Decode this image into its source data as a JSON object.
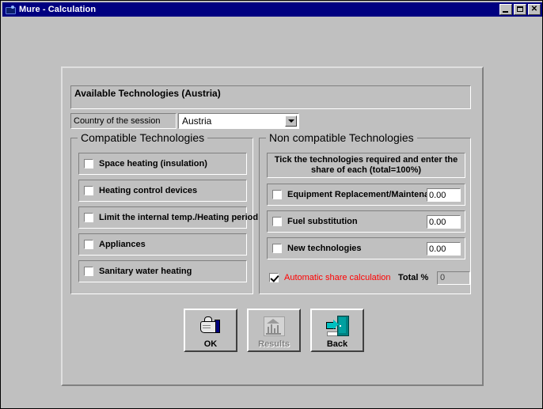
{
  "window": {
    "title": "Mure - Calculation",
    "icon": "app-icon",
    "controls": [
      {
        "name": "minimize",
        "glyph": "_"
      },
      {
        "name": "restore",
        "glyph": "❐"
      },
      {
        "name": "close",
        "glyph": "✕"
      }
    ]
  },
  "panel": {
    "header": "Available Technologies (Austria)",
    "country": {
      "label": "Country of the session",
      "value": "Austria",
      "options": [
        "Austria"
      ]
    }
  },
  "compatible": {
    "title": "Compatible Technologies",
    "items": [
      {
        "label": "Space heating (insulation)",
        "checked": false
      },
      {
        "label": "Heating control devices",
        "checked": false
      },
      {
        "label": "Limit the internal temp./Heating period",
        "checked": false
      },
      {
        "label": "Appliances",
        "checked": false
      },
      {
        "label": "Sanitary water heating",
        "checked": false
      }
    ]
  },
  "non_compatible": {
    "title": "Non compatible Technologies",
    "instruction": "Tick the technologies required and enter the share of each (total=100%)",
    "items": [
      {
        "label": "Equipment Replacement/Maintenance",
        "checked": false,
        "share": "0.00"
      },
      {
        "label": "Fuel substitution",
        "checked": false,
        "share": "0.00"
      },
      {
        "label": "New technologies",
        "checked": false,
        "share": "0.00"
      }
    ],
    "auto_share": {
      "label": "Automatic share calculation",
      "checked": true,
      "color": "#ff0000"
    },
    "total": {
      "label": "Total %",
      "value": "0"
    }
  },
  "buttons": [
    {
      "label": "OK",
      "icon": "thumbs-up-icon",
      "disabled": false
    },
    {
      "label": "Results",
      "icon": "report-chart-icon",
      "disabled": true
    },
    {
      "label": "Back",
      "icon": "exit-door-icon",
      "disabled": false
    }
  ],
  "colors": {
    "titlebar": "#000080",
    "face": "#c0c0c0",
    "accent_red": "#ff0000",
    "door_teal": "#008080"
  }
}
